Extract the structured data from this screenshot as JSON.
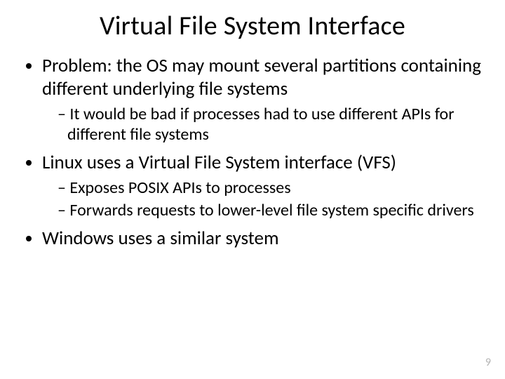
{
  "title": "Virtual File System Interface",
  "bullets": {
    "b1": "Problem: the OS may mount several partitions containing different underlying file systems",
    "b1s1": "It would be bad if processes had to use different APIs for different file systems",
    "b2": "Linux uses a Virtual File System interface (VFS)",
    "b2s1": "Exposes POSIX APIs to processes",
    "b2s2": "Forwards requests to lower-level file system specific drivers",
    "b3": "Windows uses a similar system"
  },
  "page_number": "9"
}
